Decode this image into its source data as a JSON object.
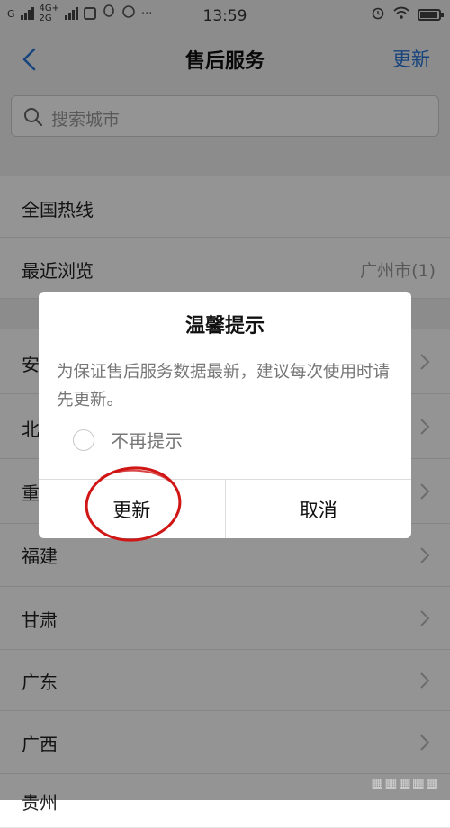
{
  "status_bar": {
    "carrier_left": "G",
    "net_top": "4G+",
    "net_bottom": "2G",
    "time": "13:59"
  },
  "nav": {
    "title": "售后服务",
    "update_label": "更新"
  },
  "search": {
    "placeholder": "搜索城市"
  },
  "list": {
    "hotline": "全国热线",
    "recent": "最近浏览",
    "recent_value": "广州市(1)",
    "provinces": [
      "安",
      "北",
      "重",
      "福建",
      "甘肃",
      "广东",
      "广西",
      "贵州"
    ]
  },
  "dialog": {
    "title": "温馨提示",
    "message": "为保证售后服务数据最新，建议每次使用时请先更新。",
    "dont_show": "不再提示",
    "confirm": "更新",
    "cancel": "取消"
  },
  "colors": {
    "accent": "#2a76d9",
    "annotation": "#d01515"
  }
}
